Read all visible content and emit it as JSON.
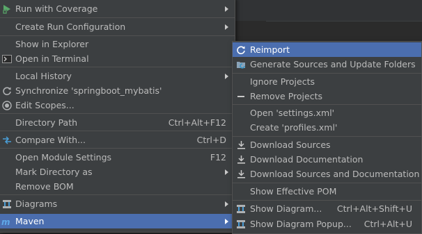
{
  "main_menu": {
    "items": [
      {
        "label": "Run with Coverage",
        "icon": "coverage-icon",
        "submenu": true
      },
      {
        "label": "Create Run Configuration",
        "submenu": true
      },
      {
        "label": "Show in Explorer"
      },
      {
        "label": "Open in Terminal",
        "icon": "terminal-icon"
      },
      {
        "label": "Local History",
        "submenu": true
      },
      {
        "label": "Synchronize 'springboot_mybatis'",
        "icon": "sync-icon"
      },
      {
        "label": "Edit Scopes...",
        "icon": "scopes-icon"
      },
      {
        "label": "Directory Path",
        "shortcut": "Ctrl+Alt+F12"
      },
      {
        "label": "Compare With...",
        "icon": "compare-icon",
        "shortcut": "Ctrl+D"
      },
      {
        "label": "Open Module Settings",
        "shortcut": "F12"
      },
      {
        "label": "Mark Directory as",
        "submenu": true
      },
      {
        "label": "Remove BOM"
      },
      {
        "label": "Diagrams",
        "icon": "diagrams-icon",
        "submenu": true
      },
      {
        "label": "Maven",
        "icon": "maven-icon",
        "submenu": true,
        "selected": true
      }
    ]
  },
  "maven_submenu": {
    "items": [
      {
        "label": "Reimport",
        "icon": "reimport-icon",
        "selected": true
      },
      {
        "label": "Generate Sources and Update Folders",
        "icon": "generate-sources-icon"
      },
      {
        "label": "Ignore Projects"
      },
      {
        "label": "Remove Projects",
        "icon": "minus-icon"
      },
      {
        "label": "Open 'settings.xml'"
      },
      {
        "label": "Create 'profiles.xml'"
      },
      {
        "label": "Download Sources",
        "icon": "download-icon"
      },
      {
        "label": "Download Documentation",
        "icon": "download-icon"
      },
      {
        "label": "Download Sources and Documentation",
        "icon": "download-icon"
      },
      {
        "label": "Show Effective POM"
      },
      {
        "label": "Show Diagram...",
        "icon": "diagram-icon",
        "shortcut": "Ctrl+Alt+Shift+U"
      },
      {
        "label": "Show Diagram Popup...",
        "icon": "diagram-icon",
        "shortcut": "Ctrl+Alt+U"
      }
    ]
  },
  "colors": {
    "menu_bg": "#3c3f41",
    "selection": "#4b6eaf",
    "text": "#bbbbbb",
    "separator": "#515151"
  }
}
